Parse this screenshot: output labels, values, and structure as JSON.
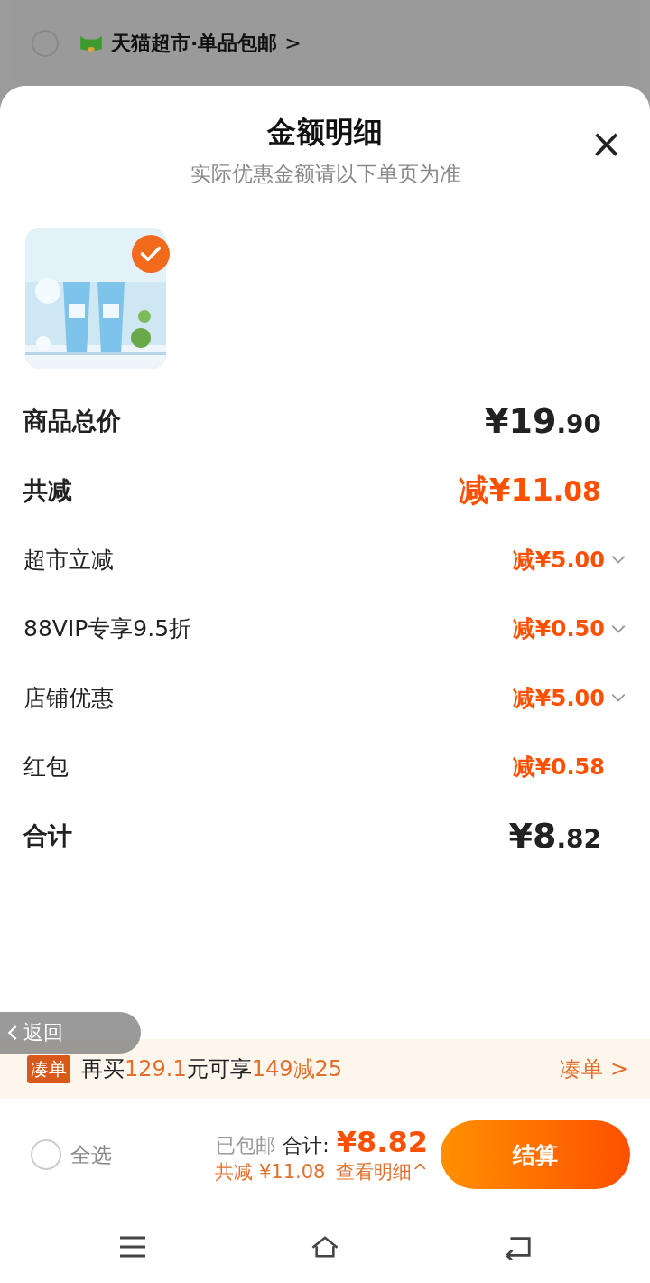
{
  "background_store": {
    "selected": false,
    "name": "天猫超市·单品包邮",
    "chevron": ">"
  },
  "sheet": {
    "title": "金额明细",
    "subtitle": "实际优惠金额请以下单页为准",
    "close": "×"
  },
  "product": {
    "kind": "picture",
    "selected": true
  },
  "rows": [
    {
      "kind": "total",
      "label": "商品总价",
      "value": "¥19.90",
      "expandable": false
    },
    {
      "kind": "discount",
      "label": "共减",
      "value": "减¥11.08",
      "expandable": false
    },
    {
      "kind": "item",
      "label": "超市立减",
      "value": "减¥5.00",
      "expandable": true
    },
    {
      "kind": "item",
      "label": "88VIP专享9.5折",
      "value": "减¥0.50",
      "expandable": true
    },
    {
      "kind": "item",
      "label": "店铺优惠",
      "value": "减¥5.00",
      "expandable": true
    },
    {
      "kind": "item",
      "label": "红包",
      "value": "减¥0.58",
      "expandable": false
    },
    {
      "kind": "total",
      "label": "合计",
      "value": "¥8.82",
      "expandable": false
    }
  ],
  "back_overlay": {
    "label": "返回"
  },
  "promo": {
    "tag": "凑单",
    "segments": [
      {
        "text": "再买",
        "highlight": false
      },
      {
        "text": "129.1",
        "highlight": true
      },
      {
        "text": "元可享",
        "highlight": false
      },
      {
        "text": "149减25",
        "highlight": true
      }
    ],
    "link": "凑单 >"
  },
  "footer": {
    "select_all": {
      "label": "全选",
      "checked": false
    },
    "shipping": "已包邮",
    "total_label": "合计:",
    "total": "¥8.82",
    "saved": "共减 ¥11.08",
    "details": "查看明细^",
    "checkout": "结算"
  }
}
